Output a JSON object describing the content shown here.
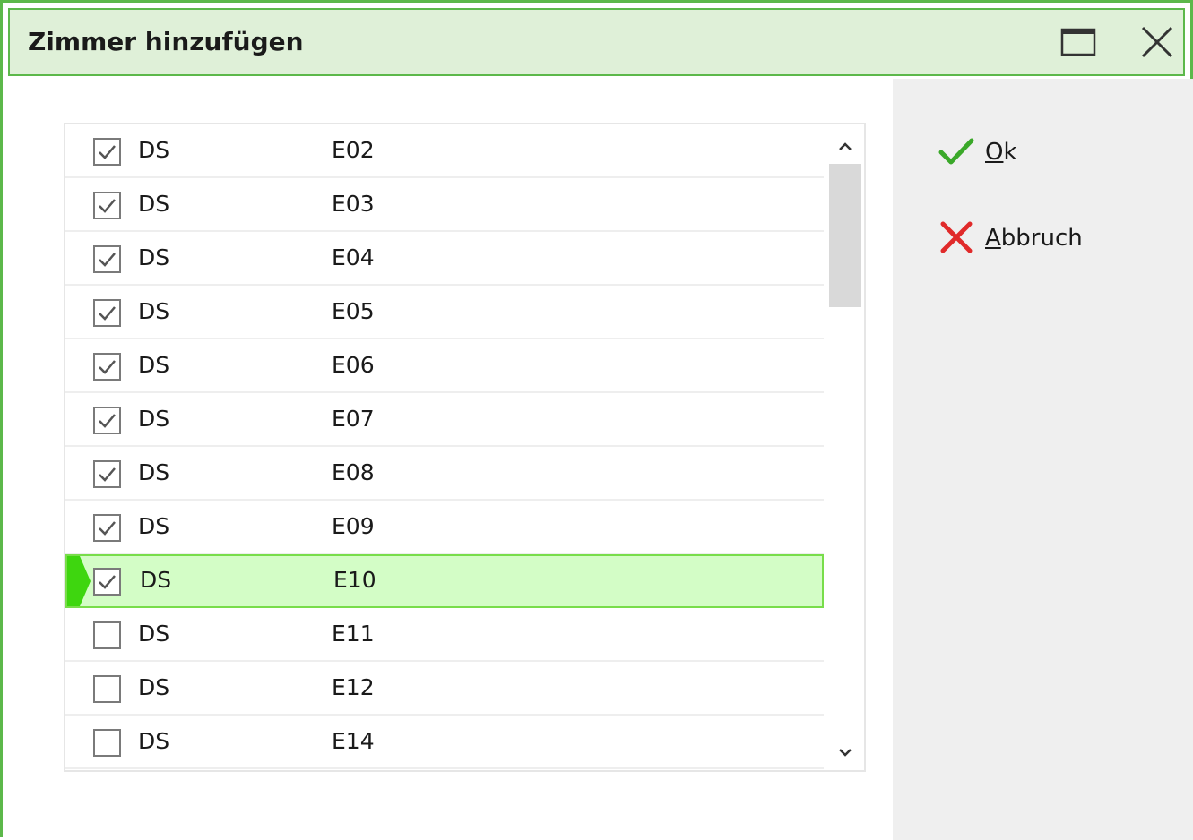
{
  "window": {
    "title": "Zimmer hinzufügen",
    "accent": "#5cb84a",
    "titlebar_bg": "#dff0d8"
  },
  "controls": {
    "maximize_icon": "maximize-icon",
    "close_icon": "close-icon"
  },
  "rooms": [
    {
      "type": "DS",
      "room": "E02",
      "checked": true
    },
    {
      "type": "DS",
      "room": "E03",
      "checked": true
    },
    {
      "type": "DS",
      "room": "E04",
      "checked": true
    },
    {
      "type": "DS",
      "room": "E05",
      "checked": true
    },
    {
      "type": "DS",
      "room": "E06",
      "checked": true
    },
    {
      "type": "DS",
      "room": "E07",
      "checked": true
    },
    {
      "type": "DS",
      "room": "E08",
      "checked": true
    },
    {
      "type": "DS",
      "room": "E09",
      "checked": true
    },
    {
      "type": "DS",
      "room": "E10",
      "checked": true,
      "selected": true
    },
    {
      "type": "DS",
      "room": "E11",
      "checked": false
    },
    {
      "type": "DS",
      "room": "E12",
      "checked": false
    },
    {
      "type": "DS",
      "room": "E14",
      "checked": false
    }
  ],
  "buttons": {
    "ok": {
      "mnemonic": "O",
      "rest": "k",
      "icon": "checkmark-icon",
      "color": "#3aa829"
    },
    "cancel": {
      "mnemonic": "A",
      "rest": "bbruch",
      "icon": "cross-icon",
      "color": "#e02a2a"
    }
  },
  "selection_color": "#d3fdc6"
}
